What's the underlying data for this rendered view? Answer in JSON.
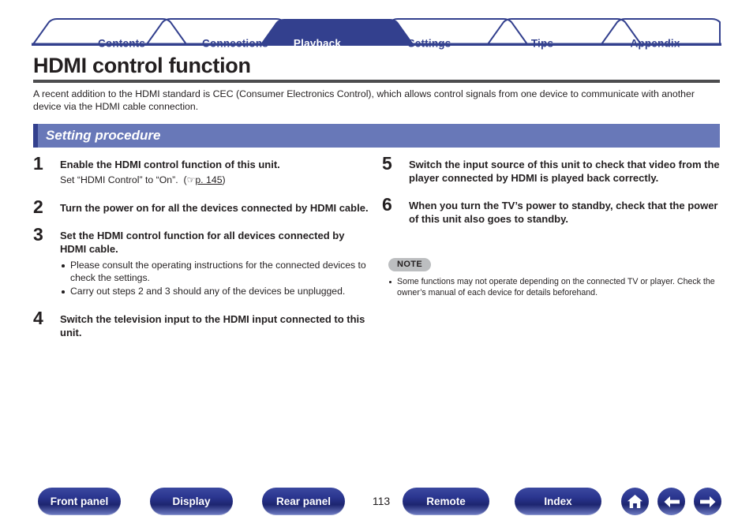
{
  "tabs": [
    {
      "label": "Contents",
      "active": false
    },
    {
      "label": "Connections",
      "active": false
    },
    {
      "label": "Playback",
      "active": true
    },
    {
      "label": "Settings",
      "active": false
    },
    {
      "label": "Tips",
      "active": false
    },
    {
      "label": "Appendix",
      "active": false
    }
  ],
  "page": {
    "title": "HDMI control function",
    "intro": "A recent addition to the HDMI standard is CEC (Consumer Electronics Control), which allows control signals from one device to communicate with another device via the HDMI cable connection.",
    "section_heading": "Setting procedure"
  },
  "steps_left": [
    {
      "num": "1",
      "head": "Enable the HDMI control function of this unit.",
      "sub_prefix": "Set “HDMI Control” to “On”.",
      "ref_icon": "pointing-hand-icon",
      "ref_glyph": "☞",
      "ref_link": "p. 145"
    },
    {
      "num": "2",
      "head": "Turn the power on for all the devices connected by HDMI cable."
    },
    {
      "num": "3",
      "head": "Set the HDMI control function for all devices connected by HDMI cable.",
      "bullets": [
        "Please consult the operating instructions for the connected devices to check the settings.",
        "Carry out steps 2 and 3 should any of the devices be unplugged."
      ]
    },
    {
      "num": "4",
      "head": "Switch the television input to the HDMI input connected to this unit."
    }
  ],
  "steps_right": [
    {
      "num": "5",
      "head": "Switch the input source of this unit to check that video from the player connected by HDMI is played back correctly."
    },
    {
      "num": "6",
      "head": "When you turn the TV’s power to standby, check that the power of this unit also goes to standby."
    }
  ],
  "note": {
    "badge": "NOTE",
    "bullets": [
      "Some functions may not operate depending on the connected TV or player. Check the owner’s manual of each device for details beforehand."
    ]
  },
  "footer": {
    "buttons": [
      {
        "label": "Front panel"
      },
      {
        "label": "Display"
      },
      {
        "label": "Rear panel"
      },
      {
        "label": "Remote"
      },
      {
        "label": "Index"
      }
    ],
    "page_number": "113",
    "icons": [
      {
        "name": "home-icon"
      },
      {
        "name": "arrow-left-icon"
      },
      {
        "name": "arrow-right-icon"
      }
    ]
  },
  "colors": {
    "brand_blue": "#33408e",
    "section_bar": "#6878b8",
    "rule_gray": "#4d4d4f",
    "note_badge": "#bcbec0"
  }
}
